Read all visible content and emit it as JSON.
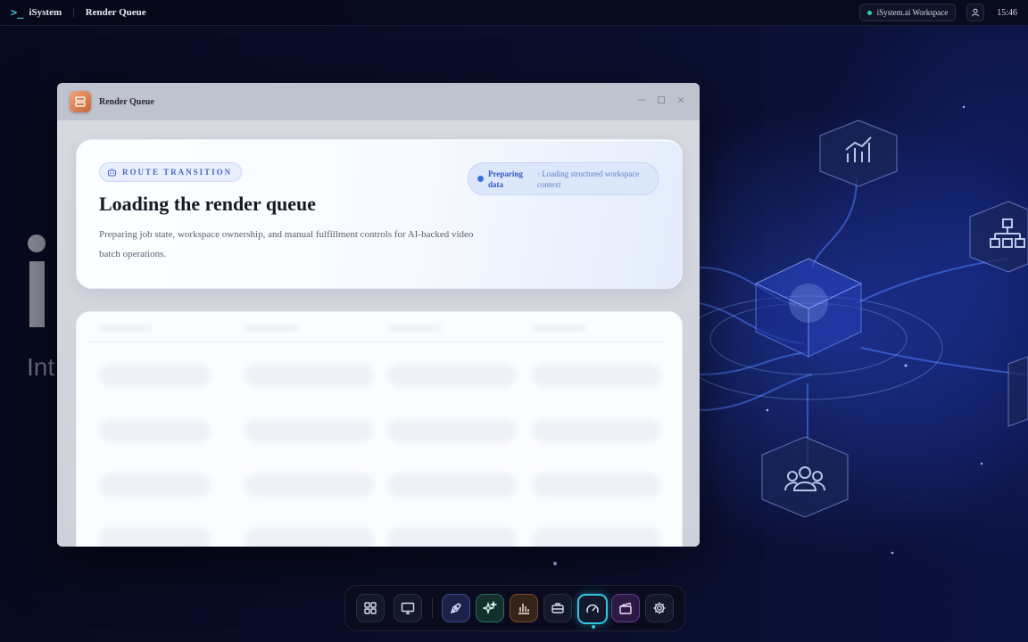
{
  "topbar": {
    "brand": "iSystem",
    "brand_icon": "terminal-prompt-icon",
    "breadcrumb": "Render Queue",
    "workspace": "iSystem.ai Workspace",
    "workspace_status_color": "#34d399",
    "clock": "15:46"
  },
  "background": {
    "ghost_subtitle": "Int"
  },
  "window": {
    "title": "Render Queue",
    "icon": "server-stack-icon",
    "controls": [
      "minimize",
      "maximize",
      "close"
    ]
  },
  "hero": {
    "badge": "ROUTE TRANSITION",
    "title": "Loading the render queue",
    "description": "Preparing job state, workspace ownership, and manual fulfillment controls for AI-backed video batch operations.",
    "status_main": "Preparing data",
    "status_sub": "· Loading structured workspace context",
    "accent_color": "#3b6fe0"
  },
  "dock": {
    "items": [
      {
        "name": "apps-grid",
        "icon": "grid-icon"
      },
      {
        "name": "desktop",
        "icon": "monitor-icon"
      },
      {
        "name": "design",
        "icon": "pen-tool-icon"
      },
      {
        "name": "ai-studio",
        "icon": "sparkles-icon"
      },
      {
        "name": "analytics",
        "icon": "bar-chart-icon"
      },
      {
        "name": "workspace",
        "icon": "briefcase-icon"
      },
      {
        "name": "dashboard",
        "icon": "gauge-icon",
        "active": true
      },
      {
        "name": "video",
        "icon": "clapperboard-icon"
      },
      {
        "name": "settings",
        "icon": "gear-icon"
      }
    ],
    "active_color": "#33c6dc"
  }
}
